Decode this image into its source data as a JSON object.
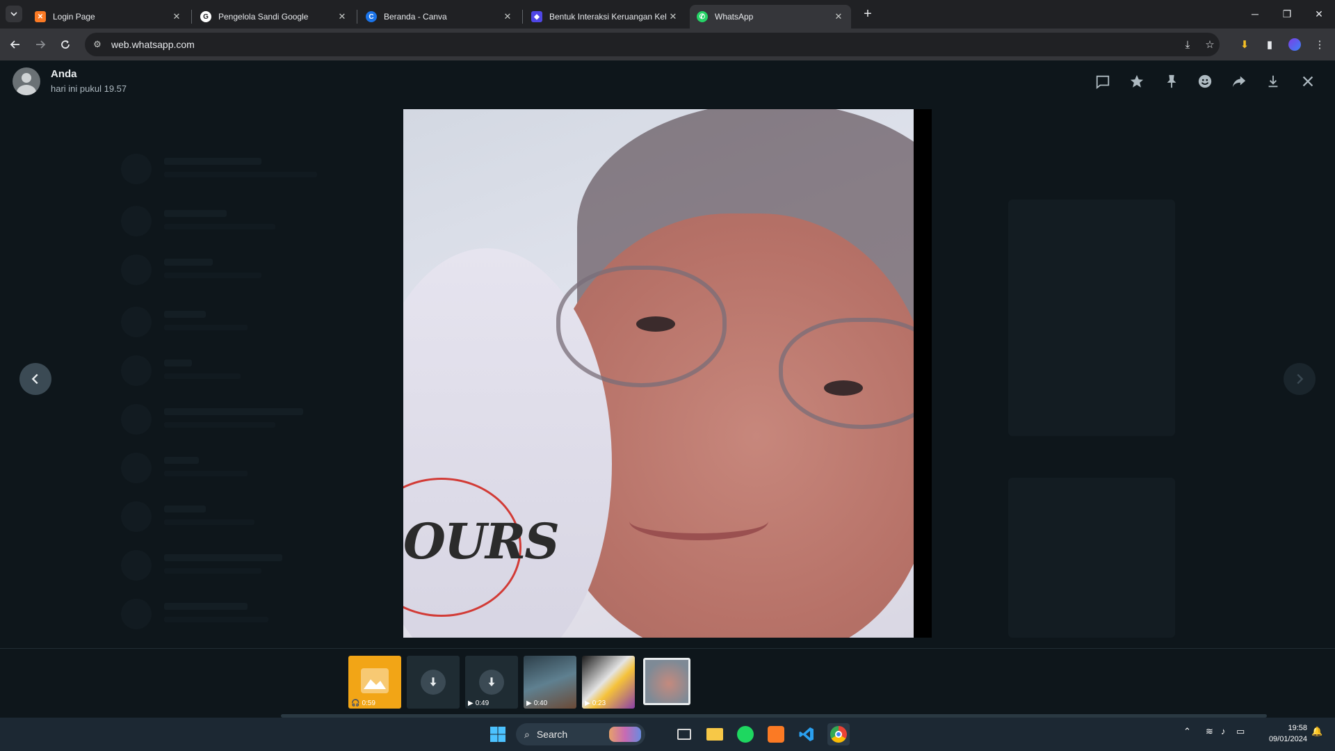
{
  "browser": {
    "tabs": [
      {
        "title": "Login Page",
        "favicon": "xampp-icon",
        "color": "#fb7a24",
        "active": false
      },
      {
        "title": "Pengelola Sandi Google",
        "favicon": "google-key-icon",
        "color": "#ffffff",
        "active": false
      },
      {
        "title": "Beranda - Canva",
        "favicon": "canva-icon",
        "color": "#1a73e8",
        "active": false
      },
      {
        "title": "Bentuk Interaksi Keruangan Kel",
        "favicon": "shield-icon",
        "color": "#4f46e5",
        "active": false
      },
      {
        "title": "WhatsApp",
        "favicon": "whatsapp-icon",
        "color": "#25d366",
        "active": true
      }
    ],
    "url": "web.whatsapp.com"
  },
  "viewer": {
    "sender": "Anda",
    "time": "hari ini pukul 19.57",
    "photo_sticker_text": "OURS",
    "header_actions": [
      "reply-icon",
      "star-icon",
      "pin-icon",
      "emoji-icon",
      "forward-icon",
      "download-icon",
      "close-icon"
    ],
    "thumbnails": [
      {
        "type": "image-audio",
        "duration": "0:59",
        "selected": true
      },
      {
        "type": "download",
        "duration": ""
      },
      {
        "type": "download-video",
        "duration": "0:49"
      },
      {
        "type": "video",
        "duration": "0:40"
      },
      {
        "type": "video",
        "duration": "0:23"
      },
      {
        "type": "photo",
        "duration": "",
        "current": true
      }
    ]
  },
  "taskbar": {
    "search_placeholder": "Search",
    "time": "19:58",
    "date": "09/01/2024"
  }
}
